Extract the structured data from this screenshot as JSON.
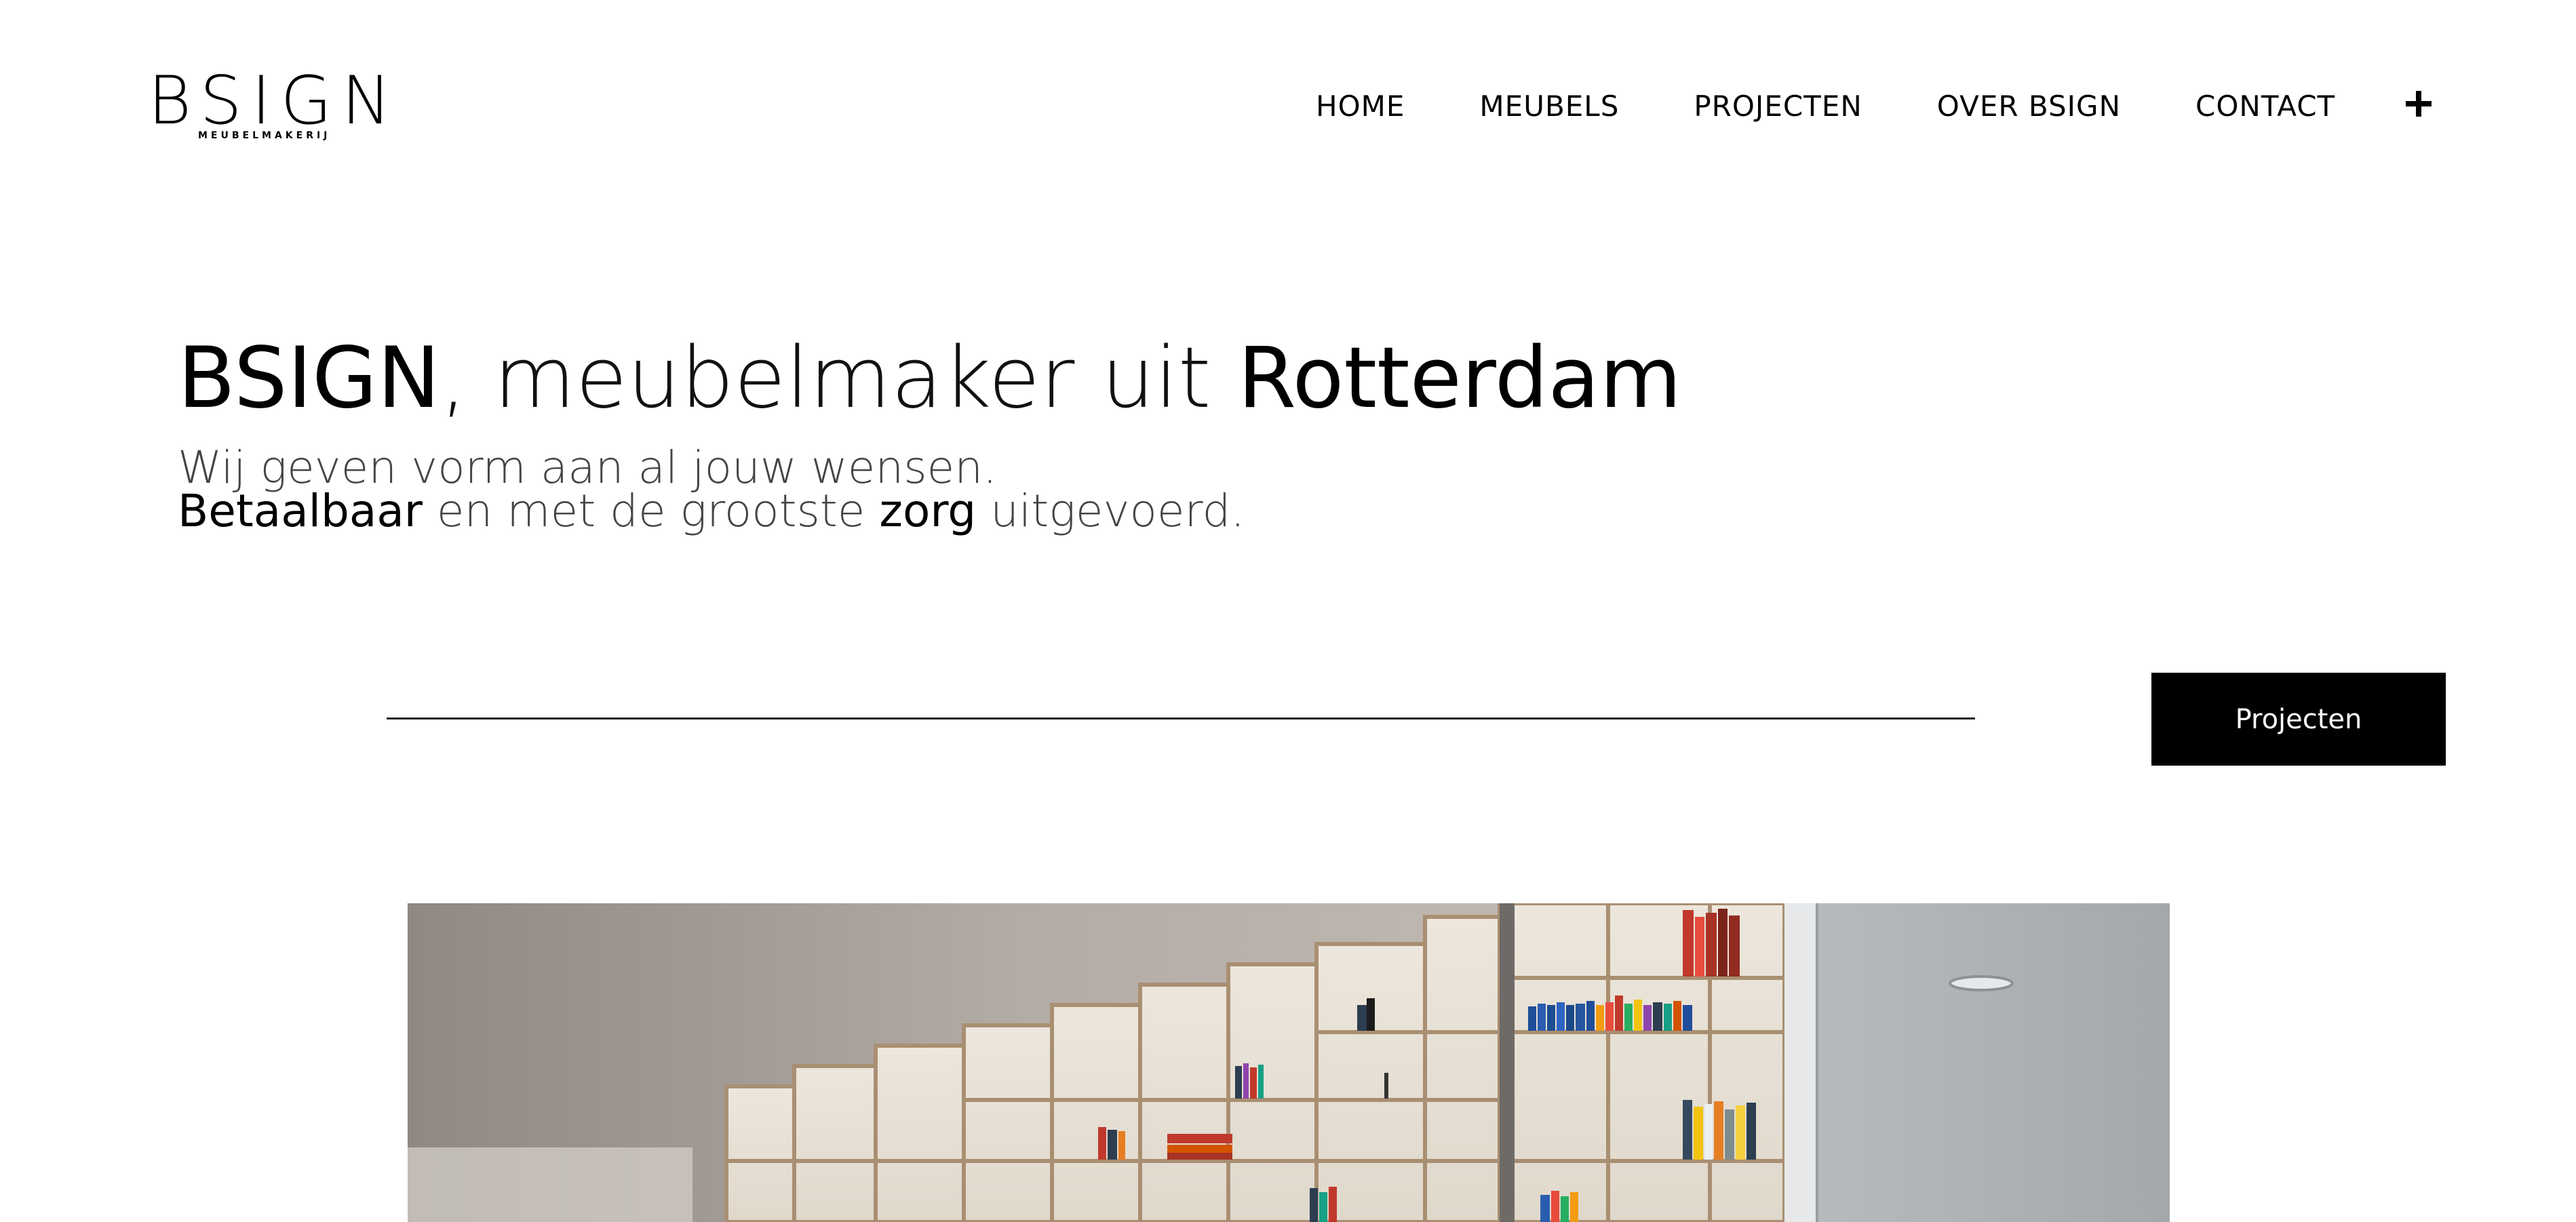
{
  "header": {
    "logo": {
      "wordmark": "BSIGN",
      "tagline": "MEUBELMAKERIJ"
    },
    "nav": {
      "items": [
        {
          "label": "HOME"
        },
        {
          "label": "MEUBELS"
        },
        {
          "label": "PROJECTEN"
        },
        {
          "label": "OVER BSIGN"
        },
        {
          "label": "CONTACT"
        }
      ],
      "more_icon": "plus-icon"
    }
  },
  "hero": {
    "title": {
      "brand": "BSIGN",
      "comma": ",",
      "middle": " meubelmaker uit ",
      "city": "Rotterdam"
    },
    "subtitle": {
      "line1": "Wij geven vorm aan al jouw wensen.",
      "line2_part1": "Betaalbaar",
      "line2_part2": " en met de grootste ",
      "line2_part3": "zorg",
      "line2_part4": " uitgevoerd."
    },
    "cta_label": "Projecten"
  },
  "colors": {
    "text": "#000000",
    "button_bg": "#000000",
    "button_text": "#ffffff",
    "background": "#ffffff"
  }
}
